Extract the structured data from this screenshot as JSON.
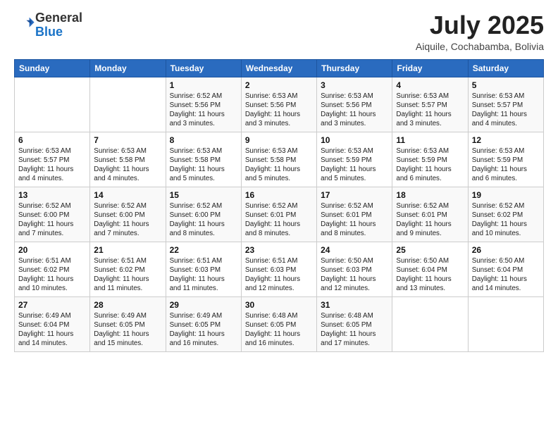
{
  "logo": {
    "general": "General",
    "blue": "Blue"
  },
  "header": {
    "month": "July 2025",
    "location": "Aiquile, Cochabamba, Bolivia"
  },
  "weekdays": [
    "Sunday",
    "Monday",
    "Tuesday",
    "Wednesday",
    "Thursday",
    "Friday",
    "Saturday"
  ],
  "weeks": [
    [
      {
        "day": "",
        "info": ""
      },
      {
        "day": "",
        "info": ""
      },
      {
        "day": "1",
        "info": "Sunrise: 6:52 AM\nSunset: 5:56 PM\nDaylight: 11 hours and 3 minutes."
      },
      {
        "day": "2",
        "info": "Sunrise: 6:53 AM\nSunset: 5:56 PM\nDaylight: 11 hours and 3 minutes."
      },
      {
        "day": "3",
        "info": "Sunrise: 6:53 AM\nSunset: 5:56 PM\nDaylight: 11 hours and 3 minutes."
      },
      {
        "day": "4",
        "info": "Sunrise: 6:53 AM\nSunset: 5:57 PM\nDaylight: 11 hours and 3 minutes."
      },
      {
        "day": "5",
        "info": "Sunrise: 6:53 AM\nSunset: 5:57 PM\nDaylight: 11 hours and 4 minutes."
      }
    ],
    [
      {
        "day": "6",
        "info": "Sunrise: 6:53 AM\nSunset: 5:57 PM\nDaylight: 11 hours and 4 minutes."
      },
      {
        "day": "7",
        "info": "Sunrise: 6:53 AM\nSunset: 5:58 PM\nDaylight: 11 hours and 4 minutes."
      },
      {
        "day": "8",
        "info": "Sunrise: 6:53 AM\nSunset: 5:58 PM\nDaylight: 11 hours and 5 minutes."
      },
      {
        "day": "9",
        "info": "Sunrise: 6:53 AM\nSunset: 5:58 PM\nDaylight: 11 hours and 5 minutes."
      },
      {
        "day": "10",
        "info": "Sunrise: 6:53 AM\nSunset: 5:59 PM\nDaylight: 11 hours and 5 minutes."
      },
      {
        "day": "11",
        "info": "Sunrise: 6:53 AM\nSunset: 5:59 PM\nDaylight: 11 hours and 6 minutes."
      },
      {
        "day": "12",
        "info": "Sunrise: 6:53 AM\nSunset: 5:59 PM\nDaylight: 11 hours and 6 minutes."
      }
    ],
    [
      {
        "day": "13",
        "info": "Sunrise: 6:52 AM\nSunset: 6:00 PM\nDaylight: 11 hours and 7 minutes."
      },
      {
        "day": "14",
        "info": "Sunrise: 6:52 AM\nSunset: 6:00 PM\nDaylight: 11 hours and 7 minutes."
      },
      {
        "day": "15",
        "info": "Sunrise: 6:52 AM\nSunset: 6:00 PM\nDaylight: 11 hours and 8 minutes."
      },
      {
        "day": "16",
        "info": "Sunrise: 6:52 AM\nSunset: 6:01 PM\nDaylight: 11 hours and 8 minutes."
      },
      {
        "day": "17",
        "info": "Sunrise: 6:52 AM\nSunset: 6:01 PM\nDaylight: 11 hours and 8 minutes."
      },
      {
        "day": "18",
        "info": "Sunrise: 6:52 AM\nSunset: 6:01 PM\nDaylight: 11 hours and 9 minutes."
      },
      {
        "day": "19",
        "info": "Sunrise: 6:52 AM\nSunset: 6:02 PM\nDaylight: 11 hours and 10 minutes."
      }
    ],
    [
      {
        "day": "20",
        "info": "Sunrise: 6:51 AM\nSunset: 6:02 PM\nDaylight: 11 hours and 10 minutes."
      },
      {
        "day": "21",
        "info": "Sunrise: 6:51 AM\nSunset: 6:02 PM\nDaylight: 11 hours and 11 minutes."
      },
      {
        "day": "22",
        "info": "Sunrise: 6:51 AM\nSunset: 6:03 PM\nDaylight: 11 hours and 11 minutes."
      },
      {
        "day": "23",
        "info": "Sunrise: 6:51 AM\nSunset: 6:03 PM\nDaylight: 11 hours and 12 minutes."
      },
      {
        "day": "24",
        "info": "Sunrise: 6:50 AM\nSunset: 6:03 PM\nDaylight: 11 hours and 12 minutes."
      },
      {
        "day": "25",
        "info": "Sunrise: 6:50 AM\nSunset: 6:04 PM\nDaylight: 11 hours and 13 minutes."
      },
      {
        "day": "26",
        "info": "Sunrise: 6:50 AM\nSunset: 6:04 PM\nDaylight: 11 hours and 14 minutes."
      }
    ],
    [
      {
        "day": "27",
        "info": "Sunrise: 6:49 AM\nSunset: 6:04 PM\nDaylight: 11 hours and 14 minutes."
      },
      {
        "day": "28",
        "info": "Sunrise: 6:49 AM\nSunset: 6:05 PM\nDaylight: 11 hours and 15 minutes."
      },
      {
        "day": "29",
        "info": "Sunrise: 6:49 AM\nSunset: 6:05 PM\nDaylight: 11 hours and 16 minutes."
      },
      {
        "day": "30",
        "info": "Sunrise: 6:48 AM\nSunset: 6:05 PM\nDaylight: 11 hours and 16 minutes."
      },
      {
        "day": "31",
        "info": "Sunrise: 6:48 AM\nSunset: 6:05 PM\nDaylight: 11 hours and 17 minutes."
      },
      {
        "day": "",
        "info": ""
      },
      {
        "day": "",
        "info": ""
      }
    ]
  ]
}
